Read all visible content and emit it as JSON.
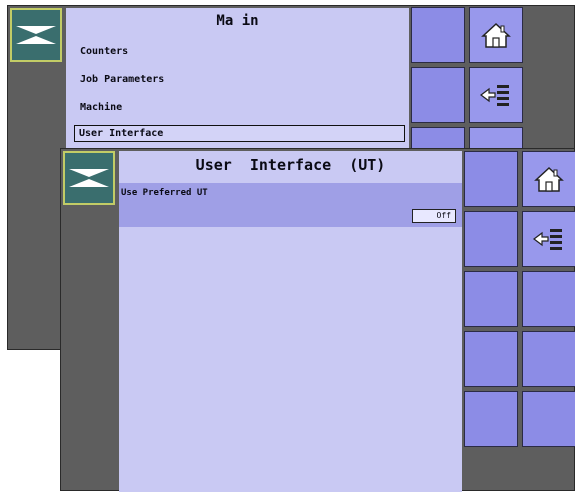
{
  "back_screen": {
    "title": "Ma in",
    "menu": [
      {
        "label": "Counters"
      },
      {
        "label": "Job Parameters"
      },
      {
        "label": "Machine"
      },
      {
        "label": "User Interface"
      }
    ],
    "selected_item": "User Interface"
  },
  "front_screen": {
    "title": "User  Interface  (UT)",
    "settings": [
      {
        "label": "Use Preferred UT",
        "value": "Off"
      }
    ]
  },
  "icons": {
    "logo": "sprayer-boom-logo-icon",
    "home": "home-icon",
    "back": "back-arrow-list-icon"
  },
  "colors": {
    "panel": "#c9c9f3",
    "softkey": "#8c8ce6",
    "frame": "#5e5e5e",
    "logo_bg": "#3a6e6e",
    "logo_border": "#c2cc66",
    "row_highlight": "#9f9fe6"
  }
}
